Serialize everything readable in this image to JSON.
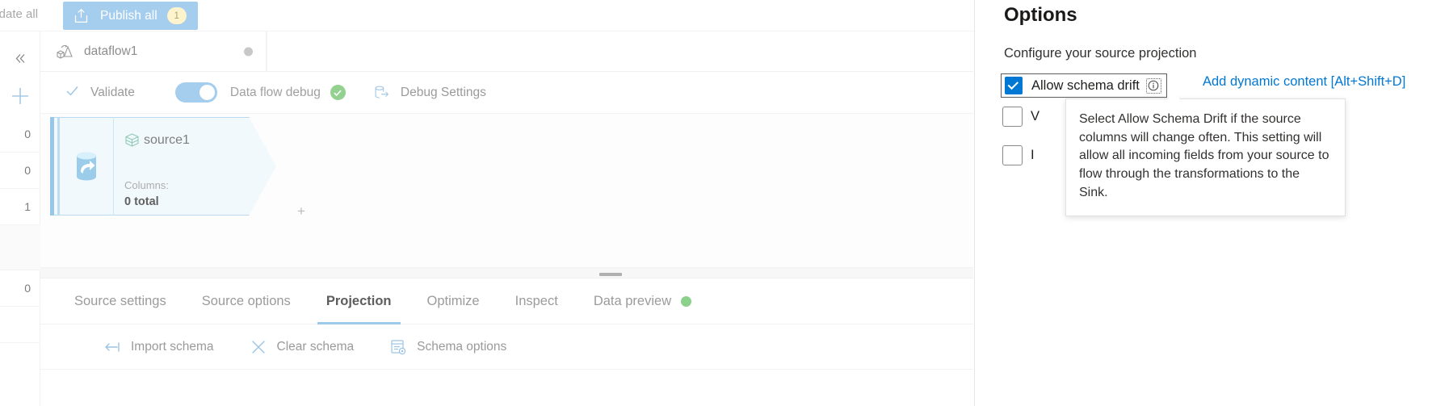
{
  "command_bar": {
    "validate_all_label": "lidate all",
    "publish_all_label": "Publish all",
    "publish_all_badge": "1",
    "publish_icon": "upload-icon"
  },
  "left_rail": {
    "collapse_icon": "chevron-double-left-icon",
    "add_icon": "plus-icon",
    "rows": [
      {
        "value": "0",
        "shaded": false
      },
      {
        "value": "0",
        "shaded": false
      },
      {
        "value": "1",
        "shaded": false
      },
      {
        "value": "",
        "shaded": true
      },
      {
        "value": "0",
        "shaded": false
      },
      {
        "value": "",
        "shaded": false
      }
    ]
  },
  "dataflow_tab": {
    "label": "dataflow1",
    "icon": "dataflow-icon",
    "status_dot_color": "#c8c8c8"
  },
  "debug_toolbar": {
    "validate_label": "Validate",
    "validate_icon": "checkmark-icon",
    "data_flow_debug_label": "Data flow debug",
    "toggle_on": true,
    "status_icon": "success-check-icon",
    "debug_settings_label": "Debug Settings",
    "debug_settings_icon": "database-arrow-icon"
  },
  "canvas": {
    "node": {
      "title": "source1",
      "title_icon": "source-stack-icon",
      "side_icon": "blob-storage-icon",
      "columns_label": "Columns:",
      "columns_value": "0 total",
      "add_icon": "plus-small-icon"
    }
  },
  "panel": {
    "tabs": [
      {
        "label": "Source settings",
        "active": false,
        "dot": false
      },
      {
        "label": "Source options",
        "active": false,
        "dot": false
      },
      {
        "label": "Projection",
        "active": true,
        "dot": false
      },
      {
        "label": "Optimize",
        "active": false,
        "dot": false
      },
      {
        "label": "Inspect",
        "active": false,
        "dot": false
      },
      {
        "label": "Data preview",
        "active": false,
        "dot": true
      }
    ],
    "data_preview_dot_color": "#8bd18b",
    "actions": [
      {
        "label": "Import schema",
        "icon": "import-arrow-icon"
      },
      {
        "label": "Clear schema",
        "icon": "close-x-icon"
      },
      {
        "label": "Schema options",
        "icon": "schema-settings-icon"
      }
    ]
  },
  "options_panel": {
    "title": "Options",
    "subtitle": "Configure your source projection",
    "allow_schema_drift": {
      "label": "Allow schema drift",
      "checked": true,
      "info_icon": "info-circle-icon"
    },
    "dynamic_content_link": "Add dynamic content [Alt+Shift+D]",
    "hidden_checkbox_1_label": "V",
    "hidden_checkbox_2_label": "I",
    "tooltip_text": "Select Allow Schema Drift if the source columns will change often. This setting will allow all incoming fields from your source to flow through the transformations to the Sink.",
    "accent_color": "#0078d4"
  }
}
